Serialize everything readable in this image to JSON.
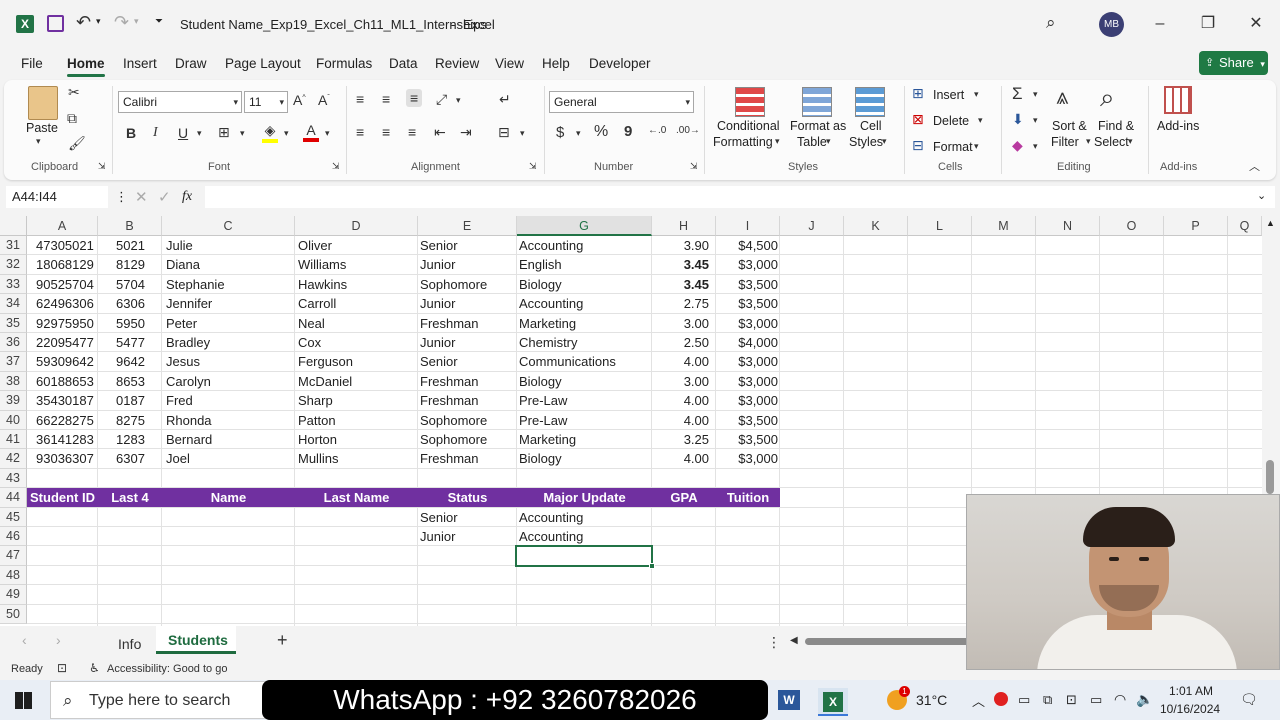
{
  "window": {
    "doc_title": "Student Name_Exp19_Excel_Ch11_ML1_Internships",
    "separator": "-",
    "app_name": "Excel",
    "user_initials": "MB",
    "accent": "#217346"
  },
  "tabs": [
    "File",
    "Home",
    "Insert",
    "Draw",
    "Page Layout",
    "Formulas",
    "Data",
    "Review",
    "View",
    "Help",
    "Developer"
  ],
  "share_label": "Share",
  "ribbon": {
    "clipboard": {
      "paste": "Paste",
      "label": "Clipboard"
    },
    "font": {
      "name": "Calibri",
      "size": "11",
      "label": "Font",
      "bold": "B",
      "italic": "I",
      "underline": "U"
    },
    "alignment": {
      "label": "Alignment"
    },
    "number": {
      "format": "General",
      "label": "Number",
      "currency": "$",
      "percent": "%",
      "comma": "9"
    },
    "styles": {
      "cond1": "Conditional",
      "cond2": "Formatting",
      "fmt1": "Format as",
      "fmt2": "Table",
      "cell1": "Cell",
      "cell2": "Styles",
      "label": "Styles"
    },
    "cells": {
      "insert": "Insert",
      "delete": "Delete",
      "format": "Format",
      "label": "Cells"
    },
    "editing": {
      "sort1": "Sort &",
      "sort2": "Filter",
      "find1": "Find &",
      "find2": "Select",
      "label": "Editing"
    },
    "addins": {
      "name": "Add-ins",
      "label": "Add-ins"
    }
  },
  "formula_bar": {
    "name_box": "A44:I44",
    "fx": "fx",
    "content": ""
  },
  "columns": [
    "A",
    "B",
    "C",
    "D",
    "E",
    "G",
    "H",
    "I",
    "J",
    "K",
    "L",
    "M",
    "N",
    "O",
    "P",
    "Q"
  ],
  "rows": [
    {
      "n": "31",
      "a": "47305021",
      "b": "5021",
      "c": "Julie",
      "d": "Oliver",
      "e": "Senior",
      "g": "Accounting",
      "h": "3.90",
      "i": "$4,500",
      "hb": false
    },
    {
      "n": "32",
      "a": "18068129",
      "b": "8129",
      "c": "Diana",
      "d": "Williams",
      "e": "Junior",
      "g": "English",
      "h": "3.45",
      "i": "$3,000",
      "hb": true
    },
    {
      "n": "33",
      "a": "90525704",
      "b": "5704",
      "c": "Stephanie",
      "d": "Hawkins",
      "e": "Sophomore",
      "g": "Biology",
      "h": "3.45",
      "i": "$3,500",
      "hb": true
    },
    {
      "n": "34",
      "a": "62496306",
      "b": "6306",
      "c": "Jennifer",
      "d": "Carroll",
      "e": "Junior",
      "g": "Accounting",
      "h": "2.75",
      "i": "$3,500",
      "hb": false
    },
    {
      "n": "35",
      "a": "92975950",
      "b": "5950",
      "c": "Peter",
      "d": "Neal",
      "e": "Freshman",
      "g": "Marketing",
      "h": "3.00",
      "i": "$3,000",
      "hb": false
    },
    {
      "n": "36",
      "a": "22095477",
      "b": "5477",
      "c": "Bradley",
      "d": "Cox",
      "e": "Junior",
      "g": "Chemistry",
      "h": "2.50",
      "i": "$4,000",
      "hb": false
    },
    {
      "n": "37",
      "a": "59309642",
      "b": "9642",
      "c": "Jesus",
      "d": "Ferguson",
      "e": "Senior",
      "g": "Communications",
      "h": "4.00",
      "i": "$3,000",
      "hb": false
    },
    {
      "n": "38",
      "a": "60188653",
      "b": "8653",
      "c": "Carolyn",
      "d": "McDaniel",
      "e": "Freshman",
      "g": "Biology",
      "h": "3.00",
      "i": "$3,000",
      "hb": false
    },
    {
      "n": "39",
      "a": "35430187",
      "b": "0187",
      "c": "Fred",
      "d": "Sharp",
      "e": "Freshman",
      "g": "Pre-Law",
      "h": "4.00",
      "i": "$3,000",
      "hb": false
    },
    {
      "n": "40",
      "a": "66228275",
      "b": "8275",
      "c": "Rhonda",
      "d": "Patton",
      "e": "Sophomore",
      "g": "Pre-Law",
      "h": "4.00",
      "i": "$3,500",
      "hb": false
    },
    {
      "n": "41",
      "a": "36141283",
      "b": "1283",
      "c": "Bernard",
      "d": "Horton",
      "e": "Sophomore",
      "g": "Marketing",
      "h": "3.25",
      "i": "$3,500",
      "hb": false
    },
    {
      "n": "42",
      "a": "93036307",
      "b": "6307",
      "c": "Joel",
      "d": "Mullins",
      "e": "Freshman",
      "g": "Biology",
      "h": "4.00",
      "i": "$3,000",
      "hb": false
    }
  ],
  "criteria_header": {
    "n": "44",
    "a": "Student ID",
    "b": "Last 4",
    "c": "Name",
    "d": "Last Name",
    "e": "Status",
    "g": "Major Update",
    "h": "GPA",
    "i": "Tuition",
    "fill": "#7030a0"
  },
  "criteria_rows": [
    {
      "n": "45",
      "e": "Senior",
      "g": "Accounting"
    },
    {
      "n": "46",
      "e": "Junior",
      "g": "Accounting"
    }
  ],
  "empty_rows": [
    "43",
    "47",
    "48",
    "49",
    "50"
  ],
  "sheets": [
    "Info",
    "Students"
  ],
  "active_sheet": "Students",
  "status": {
    "ready": "Ready",
    "accessibility": "Accessibility: Good to go"
  },
  "taskbar": {
    "search_placeholder": "Type here to search",
    "banner": "WhatsApp : +92 3260782026",
    "temp": "31°C",
    "time": "1:01 AM",
    "date": "10/16/2024",
    "weather_badge": "1"
  }
}
